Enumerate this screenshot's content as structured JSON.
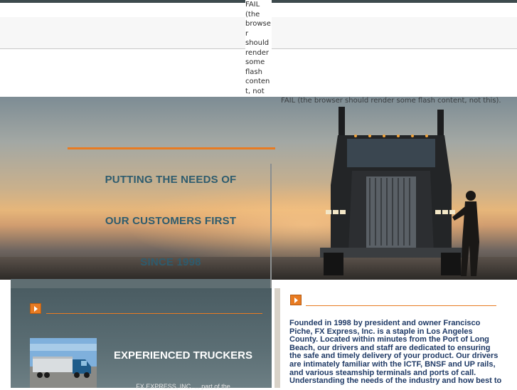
{
  "flash": {
    "fallback_narrow": "FAIL (the browser should render some flash content, not this).",
    "fallback_wide": "FAIL (the browser should render some flash content, not this)."
  },
  "hero": {
    "tagline_line1": "PUTTING THE NEEDS OF",
    "tagline_line2": "OUR CUSTOMERS FIRST",
    "tagline_line3": "SINCE 1998"
  },
  "left_panel": {
    "heading": "EXPERIENCED TRUCKERS",
    "snippet": "FX EXPRESS, INC. ... part of the"
  },
  "right_panel": {
    "about": "Founded in 1998 by president and owner Francisco Piche, FX Express, Inc. is a staple in Los Angeles County. Located within minutes from the Port of Long Beach, our drivers and staff are dedicated to ensuring the safe and timely delivery of your product. Our drivers are intimately familiar with the ICTF, BNSF and UP rails, and various steamship terminals and ports of call. Understanding the needs of the industry and how best to"
  },
  "icons": {
    "arrow": "chevron-right-icon"
  },
  "colors": {
    "accent": "#e87b22",
    "tagline": "#2e5c6e",
    "body_text": "#1f3a66",
    "panel": "#4a5c62"
  }
}
